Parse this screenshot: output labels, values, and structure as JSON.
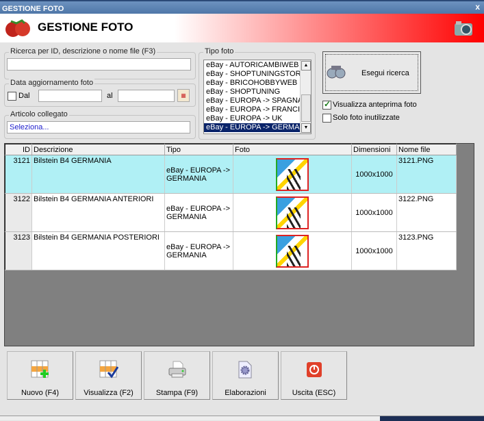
{
  "window": {
    "title": "GESTIONE FOTO",
    "close": "x"
  },
  "header": {
    "title": "GESTIONE FOTO"
  },
  "search": {
    "label": "Ricerca per ID, descrizione o nome file (F3)",
    "value": ""
  },
  "date": {
    "label": "Data aggiornamento foto",
    "from_label": "Dal",
    "to_label": "al",
    "from": "",
    "to": "",
    "enabled": false
  },
  "article": {
    "label": "Articolo collegato",
    "value": "Seleziona..."
  },
  "tipo": {
    "label": "Tipo foto",
    "items": [
      "eBay - AUTORICAMBIWEB",
      "eBay - SHOPTUNINGSTORE",
      "eBay - BRICOHOBBYWEB",
      "eBay - SHOPTUNING",
      "eBay - EUROPA -> SPAGNA",
      "eBay - EUROPA -> FRANCIA",
      "eBay - EUROPA -> UK",
      "eBay - EUROPA -> GERMANIA"
    ],
    "selected": 7
  },
  "search_button": "Esegui ricerca",
  "options": {
    "preview": {
      "label": "Visualizza anteprima foto",
      "checked": true
    },
    "unused": {
      "label": "Solo foto inutilizzate",
      "checked": false
    }
  },
  "table": {
    "columns": [
      "ID",
      "Descrizione",
      "Tipo",
      "Foto",
      "Dimensioni",
      "Nome file"
    ],
    "rows": [
      {
        "id": "3121",
        "desc": "Bilstein B4 GERMANIA",
        "tipo": "eBay - EUROPA -> GERMANIA",
        "dim": "1000x1000",
        "file": "3121.PNG"
      },
      {
        "id": "3122",
        "desc": "Bilstein B4 GERMANIA ANTERIORI",
        "tipo": "eBay - EUROPA -> GERMANIA",
        "dim": "1000x1000",
        "file": "3122.PNG"
      },
      {
        "id": "3123",
        "desc": "Bilstein B4 GERMANIA POSTERIORI",
        "tipo": "eBay - EUROPA -> GERMANIA",
        "dim": "1000x1000",
        "file": "3123.PNG"
      }
    ]
  },
  "buttons": [
    "Nuovo (F4)",
    "Visualizza (F2)",
    "Stampa (F9)",
    "Elaborazioni",
    "Uscita (ESC)"
  ]
}
